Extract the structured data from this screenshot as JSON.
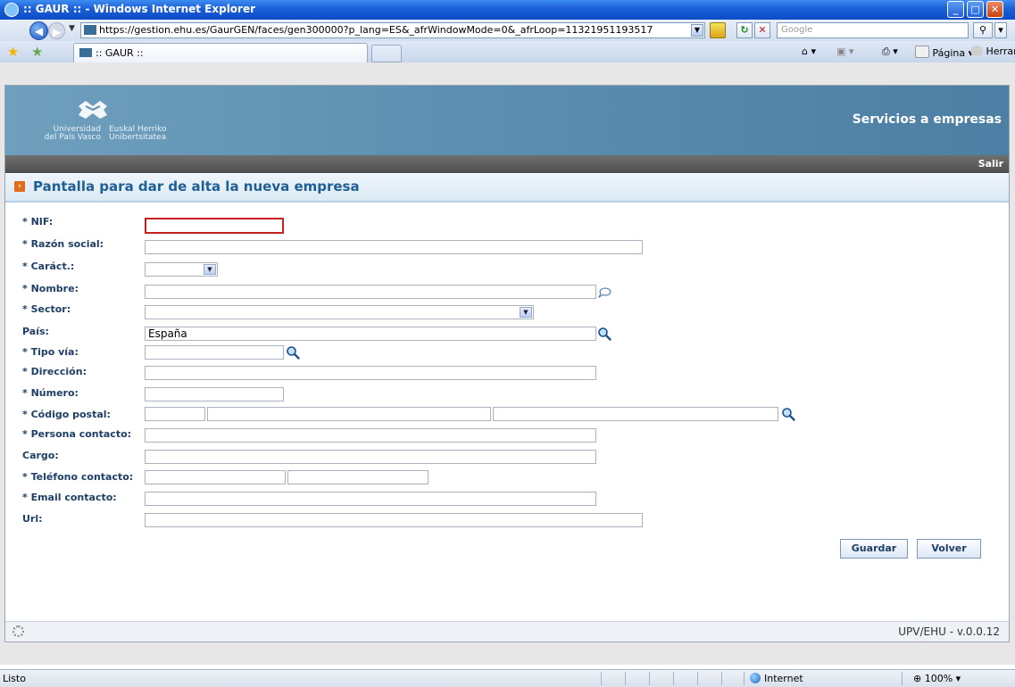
{
  "window": {
    "title": ":: GAUR :: - Windows Internet Explorer"
  },
  "addressbar": {
    "url": "https://gestion.ehu.es/GaurGEN/faces/gen300000?p_lang=ES&_afrWindowMode=0&_afrLoop=11321951193517",
    "search_placeholder": "Google"
  },
  "tab": {
    "title": ":: GAUR ::"
  },
  "commandbar": {
    "page_label": "Página",
    "tools_label": "Herramientas"
  },
  "banner": {
    "university_es_line1": "Universidad",
    "university_es_line2": "del País Vasco",
    "university_eu_line1": "Euskal Herriko",
    "university_eu_line2": "Unibertsitatea",
    "service_title": "Servicios a empresas",
    "logout_label": "Salir"
  },
  "page": {
    "title": "Pantalla para dar de alta la nueva empresa"
  },
  "form": {
    "nif_label": "* NIF:",
    "razon_label": "* Razón social:",
    "caract_label": "* Caráct.:",
    "nombre_label": "* Nombre:",
    "sector_label": "* Sector:",
    "pais_label": "País:",
    "pais_value": "España",
    "tipovia_label": "* Tipo vía:",
    "direccion_label": "* Dirección:",
    "numero_label": "* Número:",
    "cp_label": "* Código postal:",
    "persona_label": "* Persona contacto:",
    "cargo_label": "Cargo:",
    "telefono_label": "* Teléfono contacto:",
    "email_label": "* Email contacto:",
    "url_label": "Url:",
    "save_label": "Guardar",
    "back_label": "Volver"
  },
  "footer": {
    "version": "UPV/EHU - v.0.0.12"
  },
  "statusbar": {
    "status": "Listo",
    "zone": "Internet",
    "zoom": "100%"
  }
}
